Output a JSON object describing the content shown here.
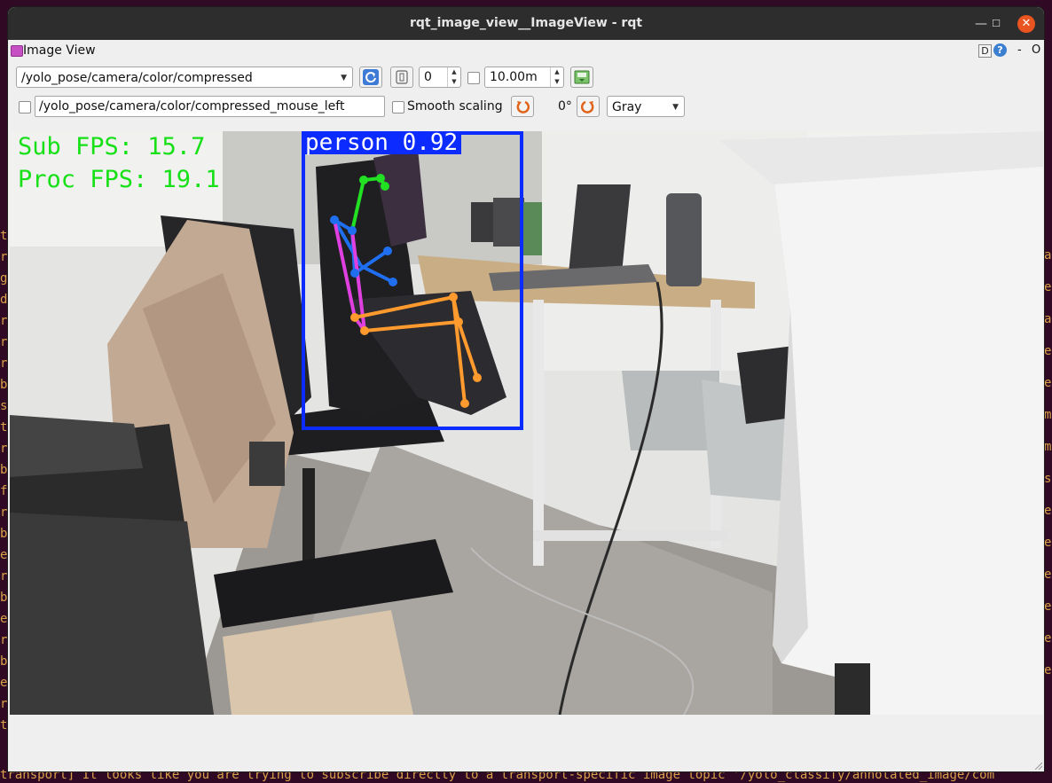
{
  "window": {
    "title": "rqt_image_view__ImageView - rqt",
    "minimize_glyph": "—",
    "maximize_glyph": "☐",
    "close_glyph": "✕"
  },
  "dock": {
    "title": "Image View",
    "help_label": "D",
    "help_q": "?",
    "dash": "-",
    "close_label": "O"
  },
  "toolbar": {
    "topic": "/yolo_pose/camera/color/compressed",
    "refresh_icon": "refresh-icon",
    "zoom_icon": "fit-icon",
    "spin_value": "0",
    "rate_value": "10.00m",
    "save_icon": "save-icon"
  },
  "toolbar2": {
    "mouse_topic": "/yolo_pose/camera/color/compressed_mouse_left",
    "smooth_label": "Smooth scaling",
    "rotate_angle": "0°",
    "colormap": "Gray"
  },
  "overlay": {
    "sub_fps": "Sub FPS: 15.7",
    "proc_fps": "Proc FPS: 19.1",
    "detection_label": "person 0.92"
  },
  "terminal": {
    "bottom_line": "transport] It looks like you are trying to subscribe directly to a transport-specific image topic '/yolo_classify/annotated_image/com",
    "left_fragments": [
      "t",
      "ra",
      "g",
      "de",
      "ra",
      "ra",
      "ra",
      "bs",
      "se",
      "tl",
      "ra",
      "bs",
      "fo",
      "ra",
      "bs",
      "e",
      "ra",
      "bs",
      "e",
      "ra",
      "bs",
      "e",
      "ra",
      "t"
    ],
    "right_fragments": [
      "a",
      "e",
      "a",
      "e",
      "e",
      "m",
      "m",
      "s",
      "e",
      "e",
      "e",
      "e",
      "e",
      "e"
    ]
  },
  "colors": {
    "accent": "#e95420",
    "bbox": "#0b2bff",
    "fps_text": "#16e016",
    "skeleton_head": "#22e022",
    "skeleton_arm": "#1f6ff0",
    "skeleton_torso": "#e040e0",
    "skeleton_leg": "#ff9a2e"
  }
}
